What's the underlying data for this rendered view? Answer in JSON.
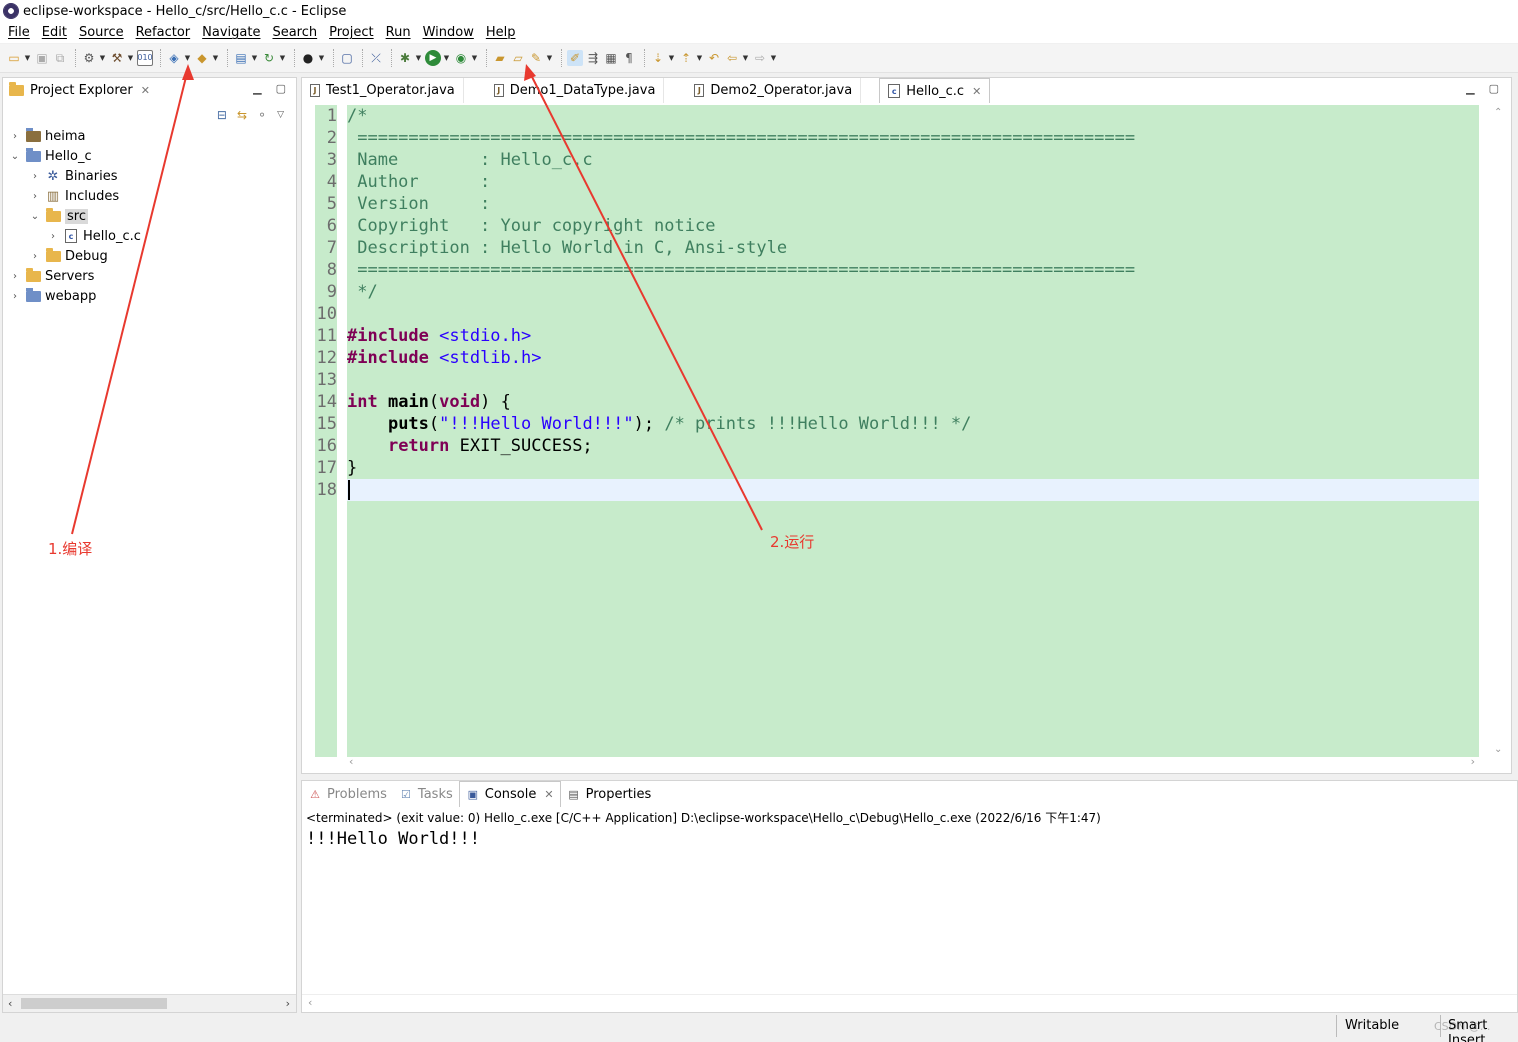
{
  "window": {
    "title": "eclipse-workspace - Hello_c/src/Hello_c.c - Eclipse"
  },
  "menu": [
    "File",
    "Edit",
    "Source",
    "Refactor",
    "Navigate",
    "Search",
    "Project",
    "Run",
    "Window",
    "Help"
  ],
  "toolbar": {
    "icons": [
      "new-icon",
      "save-icon",
      "save-all-icon",
      "cog-icon",
      "build-hammer-icon",
      "build-binary-icon",
      "open-type-icon",
      "new-class-icon",
      "new-file-icon",
      "refresh-icon",
      "user-icon",
      "terminal-icon",
      "skip-icon",
      "debug-icon",
      "run-icon",
      "external-tools-icon",
      "open-folder-icon",
      "open-project-icon",
      "search-icon",
      "highlight-icon",
      "word-wrap-icon",
      "block-selection-icon",
      "pilcrow-icon",
      "next-annotation-icon",
      "prev-annotation-icon",
      "last-edit-icon",
      "back-icon",
      "forward-icon"
    ]
  },
  "project_explorer": {
    "tab_label": "Project Explorer",
    "items": [
      {
        "label": "heima",
        "kind": "project",
        "level": 0,
        "expanded": false
      },
      {
        "label": "Hello_c",
        "kind": "project",
        "level": 0,
        "expanded": true
      },
      {
        "label": "Binaries",
        "kind": "binaries",
        "level": 1,
        "expanded": false
      },
      {
        "label": "Includes",
        "kind": "includes",
        "level": 1,
        "expanded": false
      },
      {
        "label": "src",
        "kind": "folder",
        "level": 1,
        "expanded": true,
        "selected": true
      },
      {
        "label": "Hello_c.c",
        "kind": "cfile",
        "level": 2,
        "expanded": false
      },
      {
        "label": "Debug",
        "kind": "folder",
        "level": 1,
        "expanded": false
      },
      {
        "label": "Servers",
        "kind": "folder",
        "level": 0,
        "expanded": false
      },
      {
        "label": "webapp",
        "kind": "project",
        "level": 0,
        "expanded": false
      }
    ]
  },
  "editor": {
    "tabs": [
      {
        "label": "Test1_Operator.java",
        "active": false
      },
      {
        "label": "Demo1_DataType.java",
        "active": false
      },
      {
        "label": "Demo2_Operator.java",
        "active": false
      },
      {
        "label": "Hello_c.c",
        "active": true
      }
    ],
    "line_numbers": [
      "1",
      "2",
      "3",
      "4",
      "5",
      "6",
      "7",
      "8",
      "9",
      "10",
      "11",
      "12",
      "13",
      "14",
      "15",
      "16",
      "17",
      "18"
    ],
    "lines": [
      "/*",
      " ============================================================================",
      " Name        : Hello_c.c",
      " Author      :",
      " Version     :",
      " Copyright   : Your copyright notice",
      " Description : Hello World in C, Ansi-style",
      " ============================================================================",
      " */",
      "",
      "#include <stdio.h>",
      "#include <stdlib.h>",
      "",
      "int main(void) {",
      "    puts(\"!!!Hello World!!!\"); /* prints !!!Hello World!!! */",
      "    return EXIT_SUCCESS;",
      "}",
      ""
    ]
  },
  "console": {
    "tabs": [
      {
        "label": "Problems",
        "active": false
      },
      {
        "label": "Tasks",
        "active": false
      },
      {
        "label": "Console",
        "active": true
      },
      {
        "label": "Properties",
        "active": false
      }
    ],
    "status": "<terminated> (exit value: 0) Hello_c.exe [C/C++ Application] D:\\eclipse-workspace\\Hello_c\\Debug\\Hello_c.exe (2022/6/16 下午1:47)",
    "output": "!!!Hello World!!!"
  },
  "statusbar": {
    "writable": "Writable",
    "insert_mode": "Smart Insert",
    "watermark": "CSDN @..."
  },
  "annotations": {
    "compile_label": "1.编译",
    "run_label": "2.运行",
    "color": "#e8392f"
  }
}
